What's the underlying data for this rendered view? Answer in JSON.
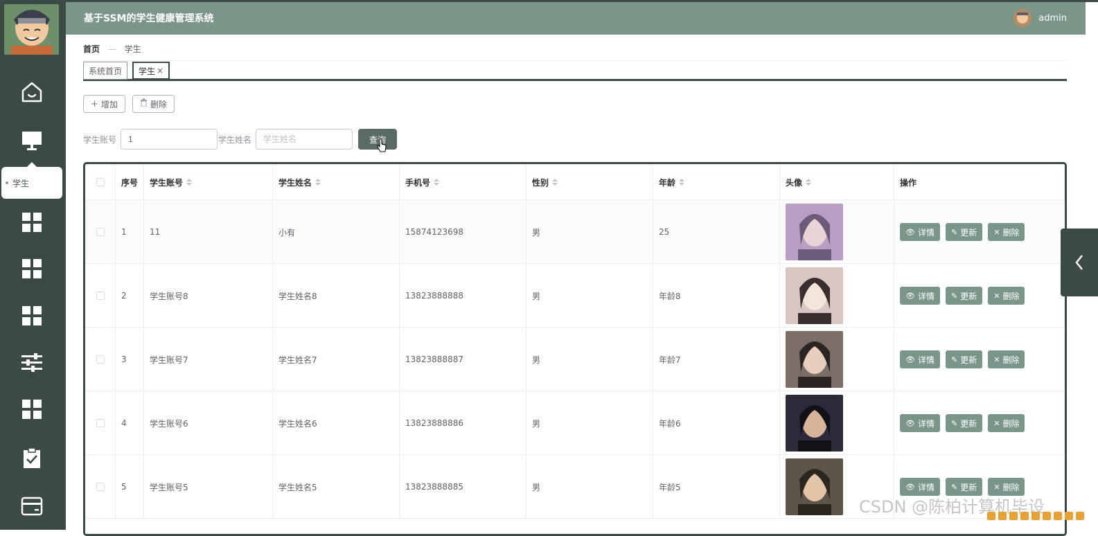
{
  "header": {
    "title": "基于SSM的学生健康管理系统",
    "user": "admin"
  },
  "sidebar": {
    "active_label": "学生",
    "icons": [
      "home-icon",
      "monitor-icon",
      "grid-icon",
      "grid-icon",
      "grid-icon",
      "sliders-icon",
      "grid-icon",
      "clipboard-check-icon",
      "card-icon"
    ]
  },
  "breadcrumb": {
    "home": "首页",
    "separator": "—",
    "current": "学生"
  },
  "tabs": [
    {
      "label": "系统首页"
    },
    {
      "label": "学生",
      "close": "×"
    }
  ],
  "toolbar": {
    "add_icon": "+",
    "add_label": "增加",
    "delete_icon": "🗑",
    "delete_label": "删除"
  },
  "search": {
    "account_label": "学生账号",
    "account_value": "1",
    "name_label": "学生姓名",
    "name_placeholder": "学生姓名",
    "query_label": "查询"
  },
  "table": {
    "columns": [
      "序号",
      "学生账号",
      "学生姓名",
      "手机号",
      "性别",
      "年龄",
      "头像",
      "操作"
    ],
    "rows": [
      {
        "no": "1",
        "account": "11",
        "name": "小有",
        "phone": "15874123698",
        "gender": "男",
        "age": "25"
      },
      {
        "no": "2",
        "account": "学生账号8",
        "name": "学生姓名8",
        "phone": "13823888888",
        "gender": "男",
        "age": "年龄8"
      },
      {
        "no": "3",
        "account": "学生账号7",
        "name": "学生姓名7",
        "phone": "13823888887",
        "gender": "男",
        "age": "年龄7"
      },
      {
        "no": "4",
        "account": "学生账号6",
        "name": "学生姓名6",
        "phone": "13823888886",
        "gender": "男",
        "age": "年龄6"
      },
      {
        "no": "5",
        "account": "学生账号5",
        "name": "学生姓名5",
        "phone": "13823888885",
        "gender": "男",
        "age": "年龄5"
      }
    ],
    "actions": {
      "detail": "详情",
      "update": "更新",
      "delete": "删除"
    }
  },
  "colors": {
    "sidebar": "#3c4a45",
    "header": "#7a9688",
    "action_button": "#7a9688",
    "query_button": "#5a6a64"
  },
  "watermark": "CSDN @陈柏计算机毕设"
}
